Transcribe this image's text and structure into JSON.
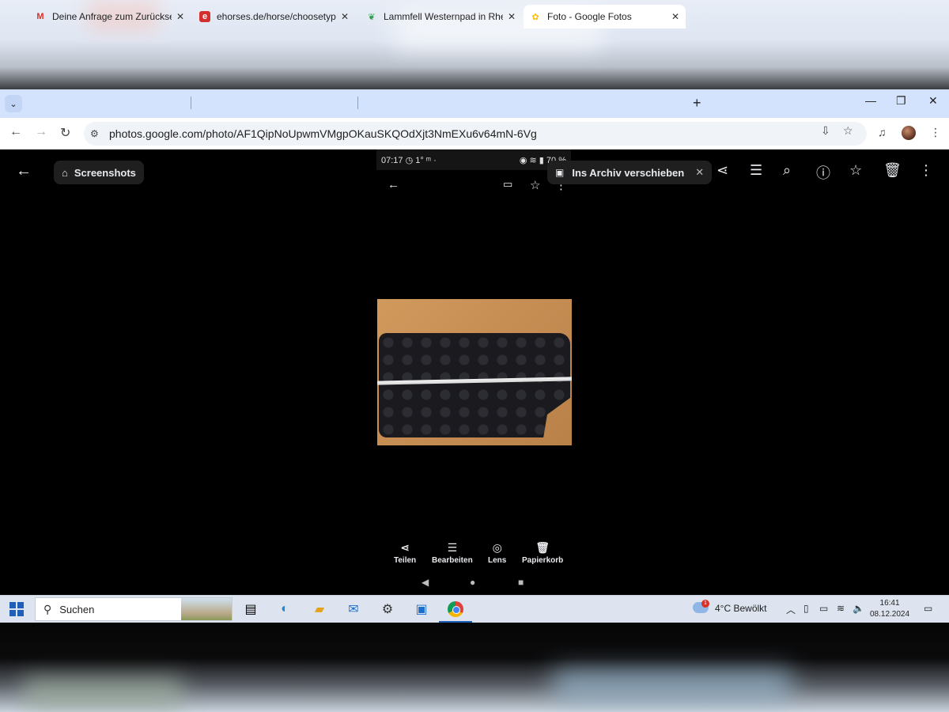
{
  "browser": {
    "tabs": [
      {
        "title": "Deine Anfrage zum Zurücksetze",
        "favicon": "gmail-icon"
      },
      {
        "title": "ehorses.de/horse/choosetype",
        "favicon": "ehorses-icon"
      },
      {
        "title": "Lammfell Westernpad in Rheinl",
        "favicon": "leaf-icon"
      },
      {
        "title": "Foto - Google Fotos",
        "favicon": "google-photos-icon",
        "active": true
      }
    ],
    "url": "photos.google.com/photo/AF1QipNoUpwmVMgpOKauSKQOdXjt3NmEXu6v64mN-6Vg"
  },
  "viewer": {
    "tag_chip": "Screenshots",
    "archive_label": "Ins Archiv verschieben",
    "phone": {
      "status_left": "07:17 ◷ 1° ᵐ ·",
      "status_right": "70 %",
      "actions": [
        "Teilen",
        "Bearbeiten",
        "Lens",
        "Papierkorb"
      ]
    }
  },
  "taskbar": {
    "search_label": "Suchen",
    "weather": "4°C  Bewölkt",
    "weather_badge": "1",
    "time": "16:41",
    "date": "08.12.2024"
  },
  "colors": {
    "tabstrip": "#d3e3fd",
    "viewer_bg": "#000000",
    "taskbar": "#dde4ef"
  }
}
